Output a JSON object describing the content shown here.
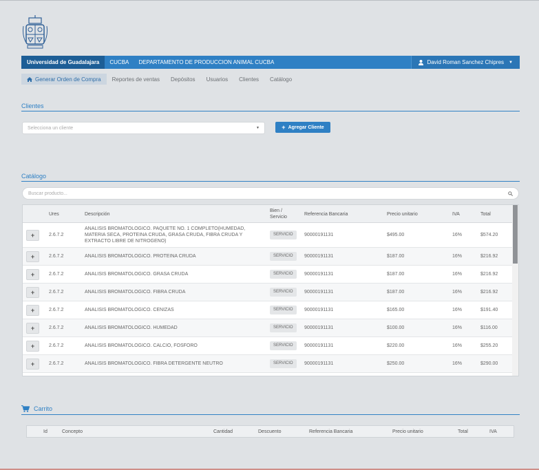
{
  "navbar": {
    "brand": "Universidad de Guadalajara",
    "links": [
      "CUCBA",
      "DEPARTAMENTO DE PRODUCCION ANIMAL CUCBA"
    ],
    "user": "David Roman Sanchez Chipres"
  },
  "subnav": {
    "items": [
      "Generar Orden de Compra",
      "Reportes de ventas",
      "Depósitos",
      "Usuarios",
      "Clientes",
      "Catálogo"
    ]
  },
  "clientes": {
    "title": "Clientes",
    "select_placeholder": "Selecciona un cliente",
    "add_button": "Agregar Cliente"
  },
  "catalogo": {
    "title": "Catálogo",
    "search_placeholder": "Buscar producto...",
    "headers": {
      "ures": "Ures",
      "descripcion": "Descripción",
      "bien": "Bien / Servicio",
      "referencia": "Referencia Bancaria",
      "precio": "Precio unitario",
      "iva": "IVA",
      "total": "Total"
    },
    "rows": [
      {
        "ures": "2.6.7.2",
        "descripcion": "ANALISIS BROMATOLOGICO. PAQUETE NO. 1 COMPLETO(HUMEDAD, MATERIA SECA, PROTEINA CRUDA, GRASA CRUDA, FIBRA CRUDA Y EXTRACTO LIBRE DE NITROGENO)",
        "tipo": "SERVICIO",
        "referencia": "90000191131",
        "precio": "$495.00",
        "iva": "16%",
        "total": "$574.20"
      },
      {
        "ures": "2.6.7.2",
        "descripcion": "ANALISIS BROMATOLOGICO. PROTEINA CRUDA",
        "tipo": "SERVICIO",
        "referencia": "90000191131",
        "precio": "$187.00",
        "iva": "16%",
        "total": "$216.92"
      },
      {
        "ures": "2.6.7.2",
        "descripcion": "ANALISIS BROMATOLOGICO. GRASA CRUDA",
        "tipo": "SERVICIO",
        "referencia": "90000191131",
        "precio": "$187.00",
        "iva": "16%",
        "total": "$216.92"
      },
      {
        "ures": "2.6.7.2",
        "descripcion": "ANALISIS BROMATOLOGICO. FIBRA CRUDA",
        "tipo": "SERVICIO",
        "referencia": "90000191131",
        "precio": "$187.00",
        "iva": "16%",
        "total": "$216.92"
      },
      {
        "ures": "2.6.7.2",
        "descripcion": "ANALISIS BROMATOLOGICO. CENIZAS",
        "tipo": "SERVICIO",
        "referencia": "90000191131",
        "precio": "$165.00",
        "iva": "16%",
        "total": "$191.40"
      },
      {
        "ures": "2.6.7.2",
        "descripcion": "ANALISIS BROMATOLOGICO. HUMEDAD",
        "tipo": "SERVICIO",
        "referencia": "90000191131",
        "precio": "$100.00",
        "iva": "16%",
        "total": "$116.00"
      },
      {
        "ures": "2.6.7.2",
        "descripcion": "ANALISIS BROMATOLOGICO. CALCIO, FOSFORO",
        "tipo": "SERVICIO",
        "referencia": "90000191131",
        "precio": "$220.00",
        "iva": "16%",
        "total": "$255.20"
      },
      {
        "ures": "2.6.7.2",
        "descripcion": "ANALISIS BROMATOLOGICO. FIBRA DETERGENTE NEUTRO",
        "tipo": "SERVICIO",
        "referencia": "90000191131",
        "precio": "$250.00",
        "iva": "16%",
        "total": "$290.00"
      }
    ],
    "add_symbol": "+"
  },
  "carrito": {
    "title": "Carrito",
    "headers": {
      "id": "Id",
      "concepto": "Concepto",
      "cantidad": "Cantidad",
      "descuento": "Descuento",
      "referencia": "Referencia Bancaria",
      "precio": "Precio unitario",
      "total": "Total",
      "iva": "IVA"
    }
  },
  "colors": {
    "primary": "#2f80c4",
    "brand_dark": "#1d5e96",
    "background": "#dfe2e5"
  }
}
